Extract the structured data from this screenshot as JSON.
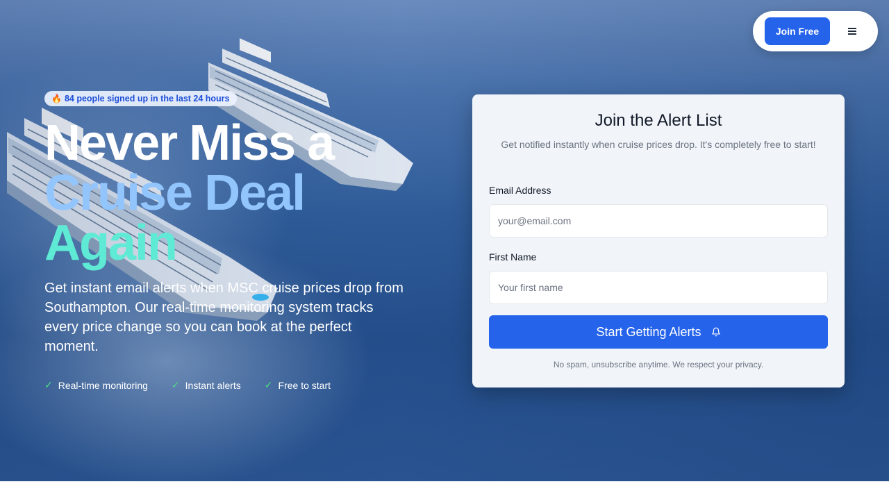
{
  "nav": {
    "join_label": "Join Free",
    "menu_icon": "menu-icon"
  },
  "hero": {
    "badge_icon": "fire-icon",
    "badge_text": "84 people signed up in the last 24 hours",
    "headline_line1": "Never Miss a",
    "headline_line2": "Cruise Deal",
    "headline_line3": "Again",
    "subtext": "Get instant email alerts when MSC cruise prices drop from Southampton. Our real-time monitoring system tracks every price change so you can book at the perfect moment.",
    "features": [
      {
        "label": "Real-time monitoring"
      },
      {
        "label": "Instant alerts"
      },
      {
        "label": "Free to start"
      }
    ]
  },
  "form": {
    "title": "Join the Alert List",
    "subtitle": "Get notified instantly when cruise prices drop. It's completely free to start!",
    "email_label": "Email Address",
    "email_placeholder": "your@email.com",
    "name_label": "First Name",
    "name_placeholder": "Your first name",
    "submit_label": "Start Getting Alerts",
    "submit_icon": "bell-icon",
    "privacy_note": "No spam, unsubscribe anytime. We respect your privacy."
  },
  "colors": {
    "accent": "#2563eb",
    "headline_white": "#ffffff",
    "headline_blue": "#93c5fd",
    "headline_teal": "#5eead4",
    "check_green": "#4ade80"
  }
}
